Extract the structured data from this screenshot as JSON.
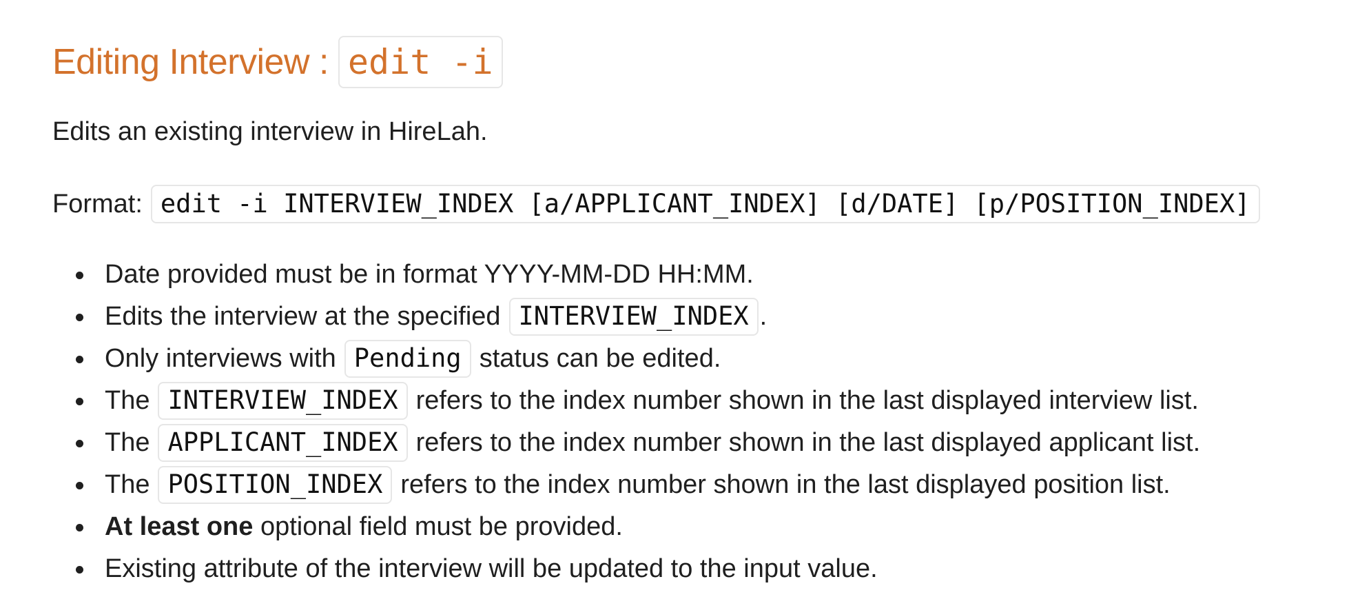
{
  "heading": {
    "text": "Editing Interview :",
    "code": "edit -i"
  },
  "intro": "Edits an existing interview in HireLah.",
  "format": {
    "label": "Format:",
    "code": "edit -i INTERVIEW_INDEX [a/APPLICANT_INDEX] [d/DATE] [p/POSITION_INDEX]"
  },
  "notes": [
    {
      "text": "Date provided must be in format YYYY-MM-DD HH:MM."
    },
    {
      "before": "Edits the interview at the specified",
      "code": "INTERVIEW_INDEX",
      "after": "."
    },
    {
      "before": "Only interviews with",
      "code": "Pending",
      "after": "status can be edited."
    },
    {
      "before": "The",
      "code": "INTERVIEW_INDEX",
      "after": "refers to the index number shown in the last displayed interview list."
    },
    {
      "before": "The",
      "code": "APPLICANT_INDEX",
      "after": "refers to the index number shown in the last displayed applicant list."
    },
    {
      "before": "The",
      "code": "POSITION_INDEX",
      "after": "refers to the index number shown in the last displayed position list."
    },
    {
      "bold": "At least one",
      "after": "optional field must be provided."
    },
    {
      "text": "Existing attribute of the interview will be updated to the input value."
    }
  ]
}
